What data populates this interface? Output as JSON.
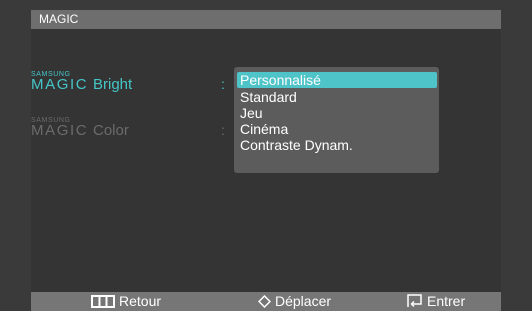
{
  "header": {
    "title": "MAGIC"
  },
  "menu": {
    "items": [
      {
        "brand_top": "SAMSUNG",
        "brand_bottom": "MAGIC",
        "name": "Bright",
        "separator": ":"
      },
      {
        "brand_top": "SAMSUNG",
        "brand_bottom": "MAGIC",
        "name": "Color",
        "separator": ":"
      }
    ],
    "active_index": 0
  },
  "dropdown": {
    "options": [
      "Personnalisé",
      "Standard",
      "Jeu",
      "Cinéma",
      "Contraste Dynam."
    ],
    "selected_index": 0
  },
  "footer": {
    "items": [
      {
        "icon": "menu-icon",
        "label": "Retour"
      },
      {
        "icon": "diamond-icon",
        "label": "Déplacer"
      },
      {
        "icon": "enter-icon",
        "label": "Entrer"
      }
    ]
  },
  "colors": {
    "accent": "#45c6c8",
    "selection": "#4ec4c9",
    "inactive": "#6b6b6b"
  }
}
